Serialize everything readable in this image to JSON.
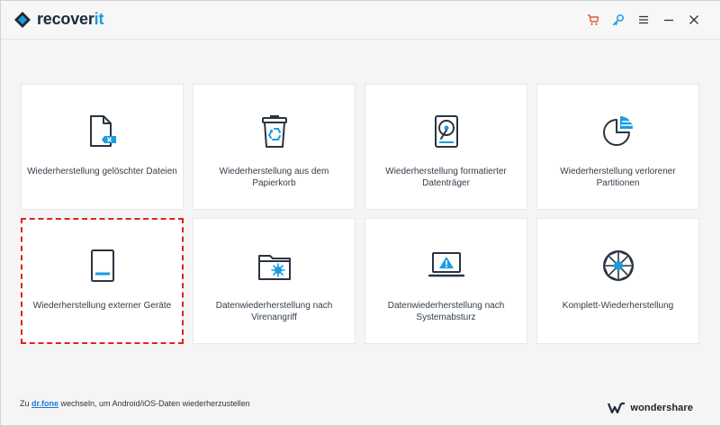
{
  "app": {
    "name_part1": "recover",
    "name_part2": "it"
  },
  "toolbar": {
    "icons": [
      "cart-icon",
      "key-icon",
      "menu-icon",
      "minimize-icon",
      "close-icon"
    ],
    "cart_color": "#e0563a",
    "key_color": "#1a9de0"
  },
  "cards": [
    {
      "id": "deleted-files",
      "label": "Wiederherstellung gelöschter Dateien",
      "icon": "deleted-file-icon"
    },
    {
      "id": "recycle-bin",
      "label": "Wiederherstellung aus dem Papierkorb",
      "icon": "recycle-bin-icon"
    },
    {
      "id": "formatted-drive",
      "label": "Wiederherstellung formatierter Datenträger",
      "icon": "hard-drive-icon"
    },
    {
      "id": "lost-partition",
      "label": "Wiederherstellung verlorener Partitionen",
      "icon": "partition-pie-icon"
    },
    {
      "id": "external-devices",
      "label": "Wiederherstellung externer Geräte",
      "icon": "external-device-icon",
      "selected": true
    },
    {
      "id": "virus-attack",
      "label": "Datenwiederherstellung nach Virenangriff",
      "icon": "virus-folder-icon"
    },
    {
      "id": "system-crash",
      "label": "Datenwiederherstellung nach Systemabsturz",
      "icon": "crash-laptop-icon"
    },
    {
      "id": "complete",
      "label": "Komplett-Wiederherstellung",
      "icon": "complete-recovery-icon"
    }
  ],
  "footer": {
    "prefix": "Zu ",
    "link": "dr.fone",
    "suffix": " wechseln, um Android/iOS-Daten wiederherzustellen",
    "brand": "wondershare"
  },
  "colors": {
    "accent": "#1a9de0",
    "icon_dark": "#2b3440",
    "selection": "#e0231c"
  }
}
